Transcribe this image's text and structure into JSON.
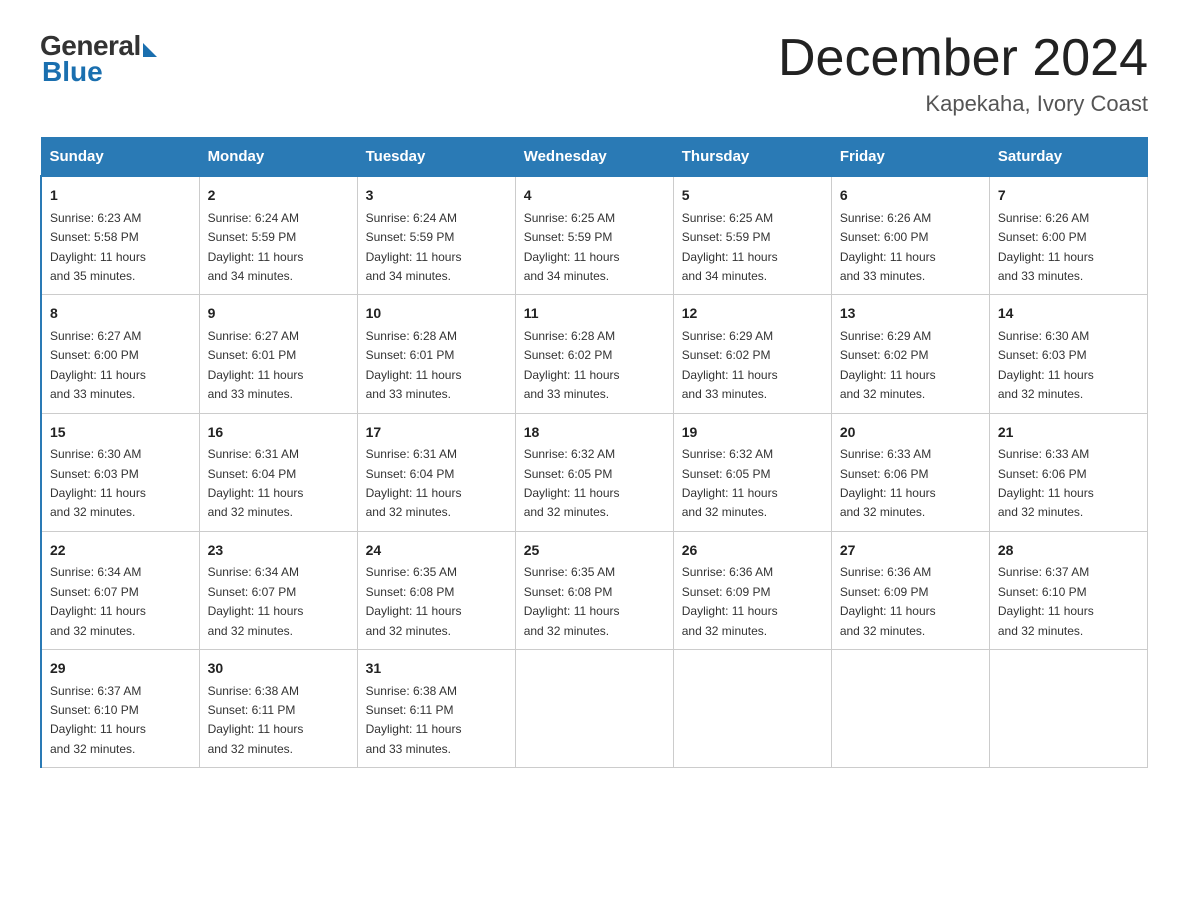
{
  "header": {
    "logo_general": "General",
    "logo_blue": "Blue",
    "month_title": "December 2024",
    "location": "Kapekaha, Ivory Coast"
  },
  "days_of_week": [
    "Sunday",
    "Monday",
    "Tuesday",
    "Wednesday",
    "Thursday",
    "Friday",
    "Saturday"
  ],
  "weeks": [
    [
      {
        "num": "1",
        "sunrise": "6:23 AM",
        "sunset": "5:58 PM",
        "daylight": "11 hours and 35 minutes."
      },
      {
        "num": "2",
        "sunrise": "6:24 AM",
        "sunset": "5:59 PM",
        "daylight": "11 hours and 34 minutes."
      },
      {
        "num": "3",
        "sunrise": "6:24 AM",
        "sunset": "5:59 PM",
        "daylight": "11 hours and 34 minutes."
      },
      {
        "num": "4",
        "sunrise": "6:25 AM",
        "sunset": "5:59 PM",
        "daylight": "11 hours and 34 minutes."
      },
      {
        "num": "5",
        "sunrise": "6:25 AM",
        "sunset": "5:59 PM",
        "daylight": "11 hours and 34 minutes."
      },
      {
        "num": "6",
        "sunrise": "6:26 AM",
        "sunset": "6:00 PM",
        "daylight": "11 hours and 33 minutes."
      },
      {
        "num": "7",
        "sunrise": "6:26 AM",
        "sunset": "6:00 PM",
        "daylight": "11 hours and 33 minutes."
      }
    ],
    [
      {
        "num": "8",
        "sunrise": "6:27 AM",
        "sunset": "6:00 PM",
        "daylight": "11 hours and 33 minutes."
      },
      {
        "num": "9",
        "sunrise": "6:27 AM",
        "sunset": "6:01 PM",
        "daylight": "11 hours and 33 minutes."
      },
      {
        "num": "10",
        "sunrise": "6:28 AM",
        "sunset": "6:01 PM",
        "daylight": "11 hours and 33 minutes."
      },
      {
        "num": "11",
        "sunrise": "6:28 AM",
        "sunset": "6:02 PM",
        "daylight": "11 hours and 33 minutes."
      },
      {
        "num": "12",
        "sunrise": "6:29 AM",
        "sunset": "6:02 PM",
        "daylight": "11 hours and 33 minutes."
      },
      {
        "num": "13",
        "sunrise": "6:29 AM",
        "sunset": "6:02 PM",
        "daylight": "11 hours and 32 minutes."
      },
      {
        "num": "14",
        "sunrise": "6:30 AM",
        "sunset": "6:03 PM",
        "daylight": "11 hours and 32 minutes."
      }
    ],
    [
      {
        "num": "15",
        "sunrise": "6:30 AM",
        "sunset": "6:03 PM",
        "daylight": "11 hours and 32 minutes."
      },
      {
        "num": "16",
        "sunrise": "6:31 AM",
        "sunset": "6:04 PM",
        "daylight": "11 hours and 32 minutes."
      },
      {
        "num": "17",
        "sunrise": "6:31 AM",
        "sunset": "6:04 PM",
        "daylight": "11 hours and 32 minutes."
      },
      {
        "num": "18",
        "sunrise": "6:32 AM",
        "sunset": "6:05 PM",
        "daylight": "11 hours and 32 minutes."
      },
      {
        "num": "19",
        "sunrise": "6:32 AM",
        "sunset": "6:05 PM",
        "daylight": "11 hours and 32 minutes."
      },
      {
        "num": "20",
        "sunrise": "6:33 AM",
        "sunset": "6:06 PM",
        "daylight": "11 hours and 32 minutes."
      },
      {
        "num": "21",
        "sunrise": "6:33 AM",
        "sunset": "6:06 PM",
        "daylight": "11 hours and 32 minutes."
      }
    ],
    [
      {
        "num": "22",
        "sunrise": "6:34 AM",
        "sunset": "6:07 PM",
        "daylight": "11 hours and 32 minutes."
      },
      {
        "num": "23",
        "sunrise": "6:34 AM",
        "sunset": "6:07 PM",
        "daylight": "11 hours and 32 minutes."
      },
      {
        "num": "24",
        "sunrise": "6:35 AM",
        "sunset": "6:08 PM",
        "daylight": "11 hours and 32 minutes."
      },
      {
        "num": "25",
        "sunrise": "6:35 AM",
        "sunset": "6:08 PM",
        "daylight": "11 hours and 32 minutes."
      },
      {
        "num": "26",
        "sunrise": "6:36 AM",
        "sunset": "6:09 PM",
        "daylight": "11 hours and 32 minutes."
      },
      {
        "num": "27",
        "sunrise": "6:36 AM",
        "sunset": "6:09 PM",
        "daylight": "11 hours and 32 minutes."
      },
      {
        "num": "28",
        "sunrise": "6:37 AM",
        "sunset": "6:10 PM",
        "daylight": "11 hours and 32 minutes."
      }
    ],
    [
      {
        "num": "29",
        "sunrise": "6:37 AM",
        "sunset": "6:10 PM",
        "daylight": "11 hours and 32 minutes."
      },
      {
        "num": "30",
        "sunrise": "6:38 AM",
        "sunset": "6:11 PM",
        "daylight": "11 hours and 32 minutes."
      },
      {
        "num": "31",
        "sunrise": "6:38 AM",
        "sunset": "6:11 PM",
        "daylight": "11 hours and 33 minutes."
      },
      null,
      null,
      null,
      null
    ]
  ],
  "labels": {
    "sunrise": "Sunrise: ",
    "sunset": "Sunset: ",
    "daylight": "Daylight: "
  }
}
